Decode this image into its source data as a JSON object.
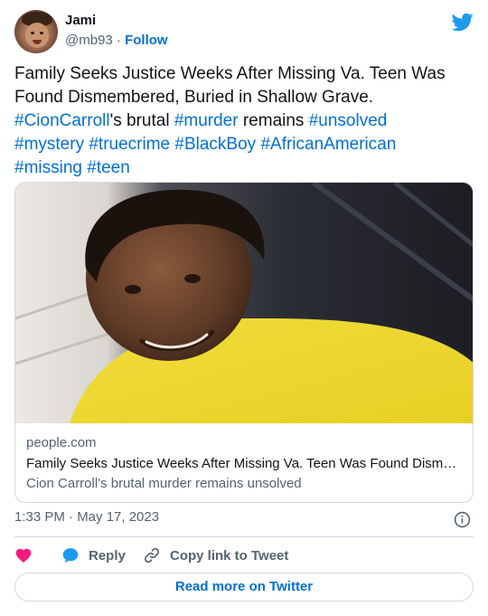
{
  "author": {
    "name": "Jami",
    "handle": "@mb93",
    "separator": "·",
    "follow_label": "Follow"
  },
  "tweet": {
    "text_plain_1": "Family Seeks Justice Weeks After Missing Va. Teen Was Found Dismembered, Buried in Shallow Grave. ",
    "hashtag_1": "#CionCarroll",
    "text_plain_2": "'s brutal ",
    "hashtag_2": "#murder",
    "text_plain_3": " remains ",
    "hashtag_3": "#unsolved",
    "hashtag_4": "#mystery",
    "hashtag_5": "#truecrime",
    "hashtag_6": "#BlackBoy",
    "hashtag_7": "#AfricanAmerican",
    "hashtag_8": "#missing",
    "hashtag_9": "#teen"
  },
  "card": {
    "domain": "people.com",
    "title": "Family Seeks Justice Weeks After Missing Va. Teen Was Found Dismembered, Buried in Shallow Grave",
    "description": "Cion Carroll's brutal murder remains unsolved"
  },
  "meta": {
    "timestamp": "1:33 PM · May 17, 2023"
  },
  "actions": {
    "reply_label": "Reply",
    "copy_label": "Copy link to Tweet",
    "read_more_label": "Read more on Twitter"
  },
  "icons": {
    "logo": "twitter-bird-icon",
    "heart": "heart-icon",
    "reply": "reply-bubble-icon",
    "copy": "link-icon",
    "info": "info-icon"
  },
  "colors": {
    "link_blue": "#006fd6",
    "twitter_blue": "#1d9bf0",
    "heart_red": "#f91880",
    "muted_text": "#536471",
    "border": "#cfd9de"
  }
}
